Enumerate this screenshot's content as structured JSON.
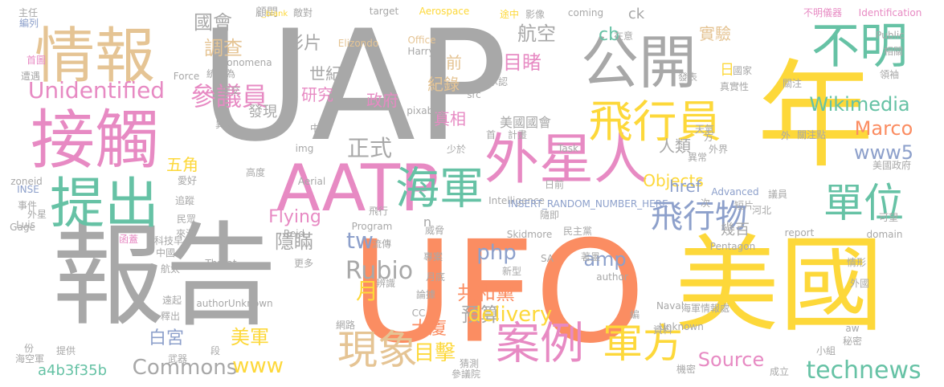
{
  "colors": {
    "gray": "#a8a8a8",
    "orange": "#fb8d62",
    "yellow": "#fdd83a",
    "pink": "#e78ac3",
    "green": "#66c2a5",
    "tan": "#e5c494",
    "blue": "#8da0cb",
    "lime": "#a6d854"
  },
  "words": [
    {
      "text": "UAP",
      "color": "gray"
    },
    {
      "text": "UFO",
      "color": "orange"
    },
    {
      "text": "年",
      "color": "yellow"
    },
    {
      "text": "報告",
      "color": "gray"
    },
    {
      "text": "美國",
      "color": "yellow"
    },
    {
      "text": "情報",
      "color": "tan"
    },
    {
      "text": "接觸",
      "color": "pink"
    },
    {
      "text": "提出",
      "color": "green"
    },
    {
      "text": "AATP",
      "color": "pink"
    },
    {
      "text": "外星人",
      "color": "pink"
    },
    {
      "text": "公開",
      "color": "gray"
    },
    {
      "text": "不明",
      "color": "green"
    },
    {
      "text": "飛行員",
      "color": "yellow"
    },
    {
      "text": "單位",
      "color": "green"
    },
    {
      "text": "海軍",
      "color": "green"
    },
    {
      "text": "案例",
      "color": "pink"
    },
    {
      "text": "軍方",
      "color": "yellow"
    },
    {
      "text": "現象",
      "color": "tan"
    },
    {
      "text": "Unidentified",
      "color": "pink"
    },
    {
      "text": "參議員",
      "color": "pink"
    },
    {
      "text": "國會",
      "color": "gray"
    },
    {
      "text": "調查",
      "color": "tan"
    },
    {
      "text": "影片",
      "color": "gray"
    },
    {
      "text": "航空",
      "color": "gray"
    },
    {
      "text": "目睹",
      "color": "pink"
    },
    {
      "text": "實驗",
      "color": "tan"
    },
    {
      "text": "cb",
      "color": "green"
    },
    {
      "text": "ck",
      "color": "gray"
    },
    {
      "text": "Wikimedia",
      "color": "green"
    },
    {
      "text": "Marco",
      "color": "orange"
    },
    {
      "text": "www5",
      "color": "blue"
    },
    {
      "text": "飛行物",
      "color": "blue"
    },
    {
      "text": "人類",
      "color": "gray"
    },
    {
      "text": "幾百",
      "color": "gray"
    },
    {
      "text": "正式",
      "color": "gray"
    },
    {
      "text": "tw",
      "color": "blue"
    },
    {
      "text": "php",
      "color": "blue"
    },
    {
      "text": "amp",
      "color": "blue"
    },
    {
      "text": "Rubio",
      "color": "gray"
    },
    {
      "text": "月",
      "color": "yellow"
    },
    {
      "text": "共和黨",
      "color": "orange"
    },
    {
      "text": "預算",
      "color": "gray"
    },
    {
      "text": "delivery",
      "color": "yellow"
    },
    {
      "text": "Objects",
      "color": "yellow"
    },
    {
      "text": "Flying",
      "color": "pink"
    },
    {
      "text": "美軍",
      "color": "yellow"
    },
    {
      "text": "白宮",
      "color": "blue"
    },
    {
      "text": "Commons",
      "color": "gray"
    },
    {
      "text": "www",
      "color": "yellow"
    },
    {
      "text": "大廈",
      "color": "orange"
    },
    {
      "text": "目擊",
      "color": "yellow"
    },
    {
      "text": "Source",
      "color": "pink"
    },
    {
      "text": "technews",
      "color": "green"
    },
    {
      "text": "a4b3f35b",
      "color": "green"
    },
    {
      "text": "五角",
      "color": "yellow"
    },
    {
      "text": "隱瞞",
      "color": "gray"
    },
    {
      "text": "世紀",
      "color": "gray"
    },
    {
      "text": "研究",
      "color": "pink"
    },
    {
      "text": "紀錄",
      "color": "tan"
    },
    {
      "text": "政府",
      "color": "pink"
    },
    {
      "text": "前",
      "color": "tan"
    },
    {
      "text": "真相",
      "color": "pink"
    },
    {
      "text": "美國國會",
      "color": "gray"
    },
    {
      "text": "發現",
      "color": "gray"
    },
    {
      "text": "href",
      "color": "blue"
    },
    {
      "text": "日",
      "color": "yellow"
    },
    {
      "text": "國家",
      "color": "gray"
    },
    {
      "text": "顧問",
      "color": "gray"
    },
    {
      "text": "敵對",
      "color": "gray"
    },
    {
      "text": "target",
      "color": "gray"
    },
    {
      "text": "Aerospace",
      "color": "yellow"
    },
    {
      "text": "途中",
      "color": "yellow"
    },
    {
      "text": "影像",
      "color": "gray"
    },
    {
      "text": "coming",
      "color": "gray"
    },
    {
      "text": "不明儀器",
      "color": "pink"
    },
    {
      "text": "Identification",
      "color": "pink"
    },
    {
      "text": "_blank",
      "color": "yellow"
    },
    {
      "text": "主任",
      "color": "gray"
    },
    {
      "text": "編列",
      "color": "blue"
    },
    {
      "text": "Elizondo",
      "color": "tan"
    },
    {
      "text": "Office",
      "color": "tan"
    },
    {
      "text": "Harry",
      "color": "gray"
    },
    {
      "text": "在意",
      "color": "gray"
    },
    {
      "text": "Public",
      "color": "gray"
    },
    {
      "text": "相關",
      "color": "gray"
    },
    {
      "text": "Phonomena",
      "color": "gray"
    },
    {
      "text": "首圖",
      "color": "pink"
    },
    {
      "text": "遭遇",
      "color": "gray"
    },
    {
      "text": "Force",
      "color": "gray"
    },
    {
      "text": "統稱為",
      "color": "gray"
    },
    {
      "text": "提交",
      "color": "gray"
    },
    {
      "text": "承認",
      "color": "gray"
    },
    {
      "text": "src",
      "color": "gray"
    },
    {
      "text": "pixabay",
      "color": "gray"
    },
    {
      "text": "發表",
      "color": "gray"
    },
    {
      "text": "真實性",
      "color": "gray"
    },
    {
      "text": "領袖",
      "color": "gray"
    },
    {
      "text": "關注",
      "color": "gray"
    },
    {
      "text": "關注點",
      "color": "gray"
    },
    {
      "text": "異象",
      "color": "gray"
    },
    {
      "text": "中",
      "color": "gray"
    },
    {
      "text": "少於",
      "color": "gray"
    },
    {
      "text": "首",
      "color": "gray"
    },
    {
      "text": "計畫",
      "color": "gray"
    },
    {
      "text": "天氣",
      "color": "gray"
    },
    {
      "text": "方",
      "color": "gray"
    },
    {
      "text": "外界",
      "color": "gray"
    },
    {
      "text": "外",
      "color": "gray"
    },
    {
      "text": "Task",
      "color": "gray"
    },
    {
      "text": "img",
      "color": "gray"
    },
    {
      "text": "異常",
      "color": "gray"
    },
    {
      "text": "美國政府",
      "color": "gray"
    },
    {
      "text": "高度",
      "color": "gray"
    },
    {
      "text": "zoneid",
      "color": "gray"
    },
    {
      "text": "INSE",
      "color": "blue"
    },
    {
      "text": "愛好",
      "color": "gray"
    },
    {
      "text": "追蹤",
      "color": "gray"
    },
    {
      "text": "Aerial",
      "color": "gray"
    },
    {
      "text": "日前",
      "color": "gray"
    },
    {
      "text": "Advanced",
      "color": "blue"
    },
    {
      "text": "議員",
      "color": "gray"
    },
    {
      "text": "事件",
      "color": "gray"
    },
    {
      "text": "外星",
      "color": "gray"
    },
    {
      "text": "Luis",
      "color": "gray"
    },
    {
      "text": "Gage",
      "color": "gray"
    },
    {
      "text": "民眾",
      "color": "gray"
    },
    {
      "text": "來源",
      "color": "gray"
    },
    {
      "text": "Intelligence",
      "color": "gray"
    },
    {
      "text": "INSERT_RANDOM_NUMBER_HERE",
      "color": "blue"
    },
    {
      "text": "飛行",
      "color": "gray"
    },
    {
      "text": "隨即",
      "color": "gray"
    },
    {
      "text": "次",
      "color": "gray"
    },
    {
      "text": "短片",
      "color": "gray"
    },
    {
      "text": "河北",
      "color": "gray"
    },
    {
      "text": "可望",
      "color": "gray"
    },
    {
      "text": "Program",
      "color": "gray"
    },
    {
      "text": "Reid",
      "color": "gray"
    },
    {
      "text": "威脅",
      "color": "gray"
    },
    {
      "text": "Skidmore",
      "color": "gray"
    },
    {
      "text": "民主黨",
      "color": "gray"
    },
    {
      "text": "report",
      "color": "gray"
    },
    {
      "text": "domain",
      "color": "gray"
    },
    {
      "text": "Pentagon",
      "color": "gray"
    },
    {
      "text": "函蓋",
      "color": "pink"
    },
    {
      "text": "科技早",
      "color": "gray"
    },
    {
      "text": "中國",
      "color": "gray"
    },
    {
      "text": "流傳",
      "color": "gray"
    },
    {
      "text": "專案",
      "color": "gray"
    },
    {
      "text": "SA",
      "color": "gray"
    },
    {
      "text": "著墨",
      "color": "gray"
    },
    {
      "text": "Threat",
      "color": "gray"
    },
    {
      "text": "更多",
      "color": "gray"
    },
    {
      "text": "航太",
      "color": "gray"
    },
    {
      "text": "辨識",
      "color": "gray"
    },
    {
      "text": "月底",
      "color": "gray"
    },
    {
      "text": "author",
      "color": "gray"
    },
    {
      "text": "情形",
      "color": "gray"
    },
    {
      "text": "外國",
      "color": "gray"
    },
    {
      "text": "遠起",
      "color": "gray"
    },
    {
      "text": "authorUnknown",
      "color": "gray"
    },
    {
      "text": "論據",
      "color": "gray"
    },
    {
      "text": "新型",
      "color": "gray"
    },
    {
      "text": "Naval",
      "color": "gray"
    },
    {
      "text": "海軍情報處",
      "color": "gray"
    },
    {
      "text": "資料",
      "color": "gray"
    },
    {
      "text": "釋出",
      "color": "gray"
    },
    {
      "text": "網路",
      "color": "gray"
    },
    {
      "text": "CC",
      "color": "gray"
    },
    {
      "text": "編",
      "color": "gray"
    },
    {
      "text": "Unknown",
      "color": "gray"
    },
    {
      "text": "aw",
      "color": "gray"
    },
    {
      "text": "段",
      "color": "gray"
    },
    {
      "text": "秘密",
      "color": "gray"
    },
    {
      "text": "份",
      "color": "gray"
    },
    {
      "text": "提供",
      "color": "gray"
    },
    {
      "text": "海空軍",
      "color": "gray"
    },
    {
      "text": "武器",
      "color": "gray"
    },
    {
      "text": "小組",
      "color": "gray"
    },
    {
      "text": "機密",
      "color": "gray"
    },
    {
      "text": "成立",
      "color": "gray"
    },
    {
      "text": "猜測",
      "color": "gray"
    },
    {
      "text": "參議院",
      "color": "gray"
    },
    {
      "text": "n",
      "color": "gray"
    },
    {
      "text": "a",
      "color": "gray"
    },
    {
      "text": "產傳",
      "color": "gray"
    }
  ]
}
